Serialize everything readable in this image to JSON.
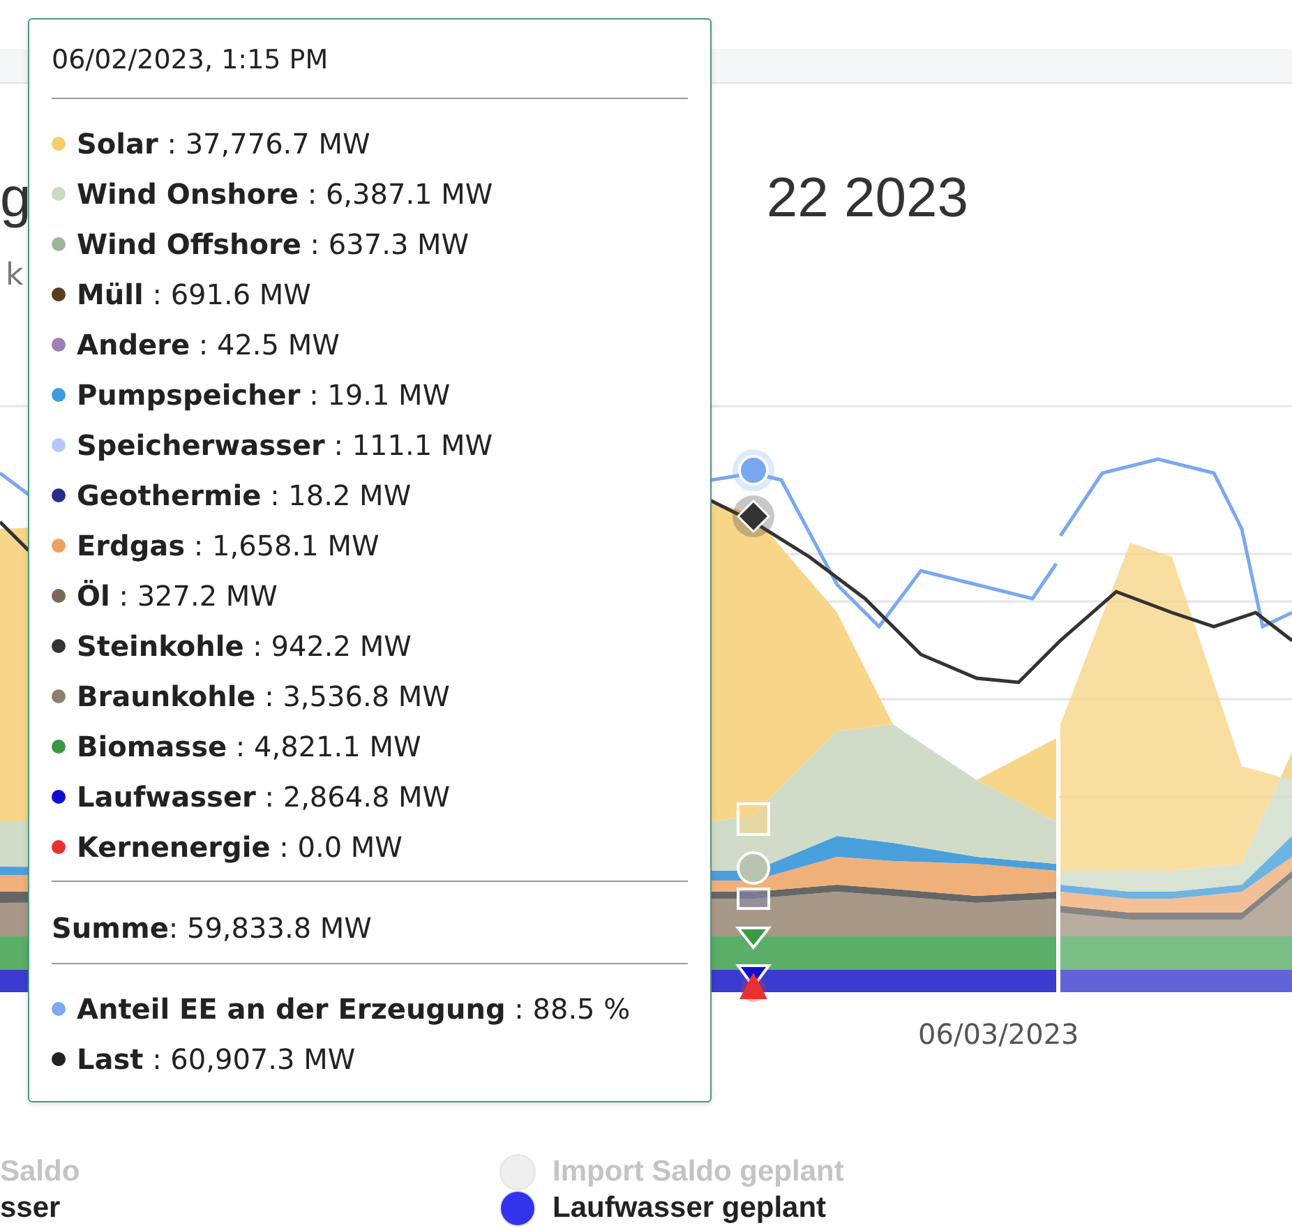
{
  "title_fragments": [
    {
      "text": "g"
    },
    {
      "text": "22 2023"
    }
  ],
  "subtitle_fragment": "k",
  "chart": {
    "x_label": "06/03/2023"
  },
  "legend": [
    {
      "label": "Saldo",
      "faded": true
    },
    {
      "label": "Import Saldo geplant",
      "faded": true,
      "color": "#eeeeee"
    },
    {
      "label": "sser",
      "faded": false
    },
    {
      "label": "Laufwasser geplant",
      "faded": false,
      "color": "#3333ee"
    }
  ],
  "tooltip": {
    "date": "06/02/2023, 1:15 PM",
    "series": [
      {
        "text": "**Solar** : 37,776.7 MW",
        "color": "#f5cd6b"
      },
      {
        "text": "**Wind Onshore** : 6,387.1 MW",
        "color": "#c8dcc0"
      },
      {
        "text": "**Wind Offshore** : 637.3 MW",
        "color": "#9fb59a"
      },
      {
        "text": "**Müll** : 691.6 MW",
        "color": "#5a3d1e"
      },
      {
        "text": "**Andere** : 42.5 MW",
        "color": "#9b7fb5"
      },
      {
        "text": "**Pumpspeicher** : 19.1 MW",
        "color": "#3d9be0"
      },
      {
        "text": "**Speicherwasser** : 111.1 MW",
        "color": "#b5c8f5"
      },
      {
        "text": "**Geothermie** : 18.2 MW",
        "color": "#2a2a8a"
      },
      {
        "text": "**Erdgas** : 1,658.1 MW",
        "color": "#f0a060"
      },
      {
        "text": "**Öl** : 327.2 MW",
        "color": "#7a6a55"
      },
      {
        "text": "**Steinkohle** : 942.2 MW",
        "color": "#333333"
      },
      {
        "text": "**Braunkohle** : 3,536.8 MW",
        "color": "#8e7e6e"
      },
      {
        "text": "**Biomasse** : 4,821.1 MW",
        "color": "#3a9a40"
      },
      {
        "text": "**Laufwasser** : 2,864.8 MW",
        "color": "#1010cc"
      },
      {
        "text": "**Kernenergie** : 0.0 MW",
        "color": "#e83030"
      }
    ],
    "sum": "**Summe**: 59,833.8 MW",
    "extra": [
      {
        "text": "**Anteil EE an der Erzeugung** : 88.5 %",
        "color": "#7fa8f0"
      },
      {
        "text": "**Last** : 60,907.3 MW",
        "color": "#222222"
      }
    ]
  }
}
